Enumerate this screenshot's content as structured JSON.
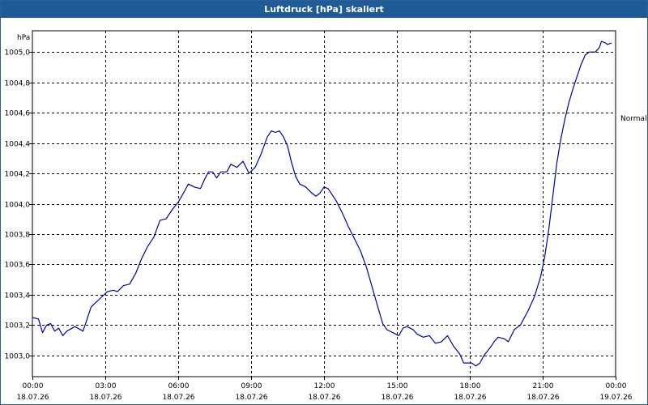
{
  "window": {
    "title": "Luftdruck [hPa] skaliert"
  },
  "chart_data": {
    "type": "line",
    "title": "Luftdruck [hPa] skaliert",
    "unit": "hPa",
    "reference_line_label": "Normal",
    "grid": true,
    "xlim": [
      "18.07.26 00:00",
      "19.07.26 00:00"
    ],
    "ylim": [
      1002.86,
      1005.14
    ],
    "y_ticks": [
      "1003,0",
      "1003,2",
      "1003,4",
      "1003,6",
      "1003,8",
      "1004,0",
      "1004,2",
      "1004,4",
      "1004,6",
      "1004,8",
      "1005,0"
    ],
    "x_ticks": [
      {
        "time": "00:00",
        "date": "18.07.26"
      },
      {
        "time": "03:00",
        "date": "18.07.26"
      },
      {
        "time": "06:00",
        "date": "18.07.26"
      },
      {
        "time": "09:00",
        "date": "18.07.26"
      },
      {
        "time": "12:00",
        "date": "18.07.26"
      },
      {
        "time": "15:00",
        "date": "18.07.26"
      },
      {
        "time": "18:00",
        "date": "18.07.26"
      },
      {
        "time": "21:00",
        "date": "18.07.26"
      },
      {
        "time": "00:00",
        "date": "19.07.26"
      }
    ],
    "series": [
      {
        "color": "#0000a0",
        "points": [
          [
            "00:00",
            1003.25
          ],
          [
            "00:15",
            1003.24
          ],
          [
            "00:25",
            1003.15
          ],
          [
            "00:35",
            1003.2
          ],
          [
            "00:45",
            1003.21
          ],
          [
            "00:55",
            1003.16
          ],
          [
            "01:05",
            1003.18
          ],
          [
            "01:15",
            1003.13
          ],
          [
            "01:25",
            1003.16
          ],
          [
            "01:45",
            1003.19
          ],
          [
            "02:05",
            1003.16
          ],
          [
            "02:25",
            1003.32
          ],
          [
            "02:45",
            1003.37
          ],
          [
            "03:05",
            1003.42
          ],
          [
            "03:20",
            1003.43
          ],
          [
            "03:30",
            1003.42
          ],
          [
            "03:45",
            1003.46
          ],
          [
            "04:00",
            1003.47
          ],
          [
            "04:15",
            1003.54
          ],
          [
            "04:30",
            1003.64
          ],
          [
            "04:45",
            1003.72
          ],
          [
            "05:00",
            1003.78
          ],
          [
            "05:15",
            1003.89
          ],
          [
            "05:30",
            1003.9
          ],
          [
            "05:45",
            1003.96
          ],
          [
            "06:00",
            1004.01
          ],
          [
            "06:15",
            1004.08
          ],
          [
            "06:25",
            1004.13
          ],
          [
            "06:40",
            1004.11
          ],
          [
            "06:55",
            1004.1
          ],
          [
            "07:05",
            1004.16
          ],
          [
            "07:15",
            1004.21
          ],
          [
            "07:25",
            1004.21
          ],
          [
            "07:35",
            1004.17
          ],
          [
            "07:45",
            1004.21
          ],
          [
            "08:00",
            1004.21
          ],
          [
            "08:10",
            1004.26
          ],
          [
            "08:25",
            1004.24
          ],
          [
            "08:40",
            1004.28
          ],
          [
            "08:55",
            1004.2
          ],
          [
            "09:10",
            1004.24
          ],
          [
            "09:25",
            1004.33
          ],
          [
            "09:40",
            1004.44
          ],
          [
            "09:50",
            1004.48
          ],
          [
            "10:00",
            1004.47
          ],
          [
            "10:10",
            1004.48
          ],
          [
            "10:20",
            1004.44
          ],
          [
            "10:30",
            1004.38
          ],
          [
            "10:40",
            1004.27
          ],
          [
            "10:50",
            1004.18
          ],
          [
            "11:00",
            1004.13
          ],
          [
            "11:15",
            1004.11
          ],
          [
            "11:30",
            1004.07
          ],
          [
            "11:40",
            1004.05
          ],
          [
            "11:50",
            1004.07
          ],
          [
            "12:00",
            1004.11
          ],
          [
            "12:10",
            1004.1
          ],
          [
            "12:30",
            1004.02
          ],
          [
            "12:45",
            1003.94
          ],
          [
            "13:00",
            1003.85
          ],
          [
            "13:15",
            1003.77
          ],
          [
            "13:30",
            1003.69
          ],
          [
            "13:45",
            1003.58
          ],
          [
            "14:00",
            1003.44
          ],
          [
            "14:15",
            1003.3
          ],
          [
            "14:25",
            1003.21
          ],
          [
            "14:35",
            1003.17
          ],
          [
            "14:50",
            1003.15
          ],
          [
            "15:05",
            1003.13
          ],
          [
            "15:15",
            1003.18
          ],
          [
            "15:25",
            1003.19
          ],
          [
            "15:40",
            1003.17
          ],
          [
            "15:50",
            1003.14
          ],
          [
            "16:05",
            1003.12
          ],
          [
            "16:20",
            1003.13
          ],
          [
            "16:35",
            1003.08
          ],
          [
            "16:50",
            1003.09
          ],
          [
            "17:05",
            1003.13
          ],
          [
            "17:20",
            1003.06
          ],
          [
            "17:35",
            1003.01
          ],
          [
            "17:45",
            1002.95
          ],
          [
            "17:55",
            1002.95
          ],
          [
            "18:05",
            1002.95
          ],
          [
            "18:15",
            1002.93
          ],
          [
            "18:25",
            1002.95
          ],
          [
            "18:35",
            1003.0
          ],
          [
            "18:50",
            1003.05
          ],
          [
            "19:00",
            1003.09
          ],
          [
            "19:10",
            1003.12
          ],
          [
            "19:25",
            1003.11
          ],
          [
            "19:35",
            1003.09
          ],
          [
            "19:50",
            1003.17
          ],
          [
            "20:05",
            1003.2
          ],
          [
            "20:15",
            1003.25
          ],
          [
            "20:25",
            1003.3
          ],
          [
            "20:40",
            1003.39
          ],
          [
            "20:55",
            1003.52
          ],
          [
            "21:05",
            1003.65
          ],
          [
            "21:15",
            1003.83
          ],
          [
            "21:25",
            1004.05
          ],
          [
            "21:35",
            1004.27
          ],
          [
            "21:45",
            1004.43
          ],
          [
            "21:55",
            1004.56
          ],
          [
            "22:05",
            1004.67
          ],
          [
            "22:15",
            1004.76
          ],
          [
            "22:25",
            1004.84
          ],
          [
            "22:35",
            1004.92
          ],
          [
            "22:45",
            1004.98
          ],
          [
            "22:55",
            1005.0
          ],
          [
            "23:10",
            1005.0
          ],
          [
            "23:20",
            1005.03
          ],
          [
            "23:25",
            1005.07
          ],
          [
            "23:35",
            1005.06
          ],
          [
            "23:40",
            1005.05
          ],
          [
            "23:50",
            1005.06
          ]
        ]
      }
    ]
  }
}
